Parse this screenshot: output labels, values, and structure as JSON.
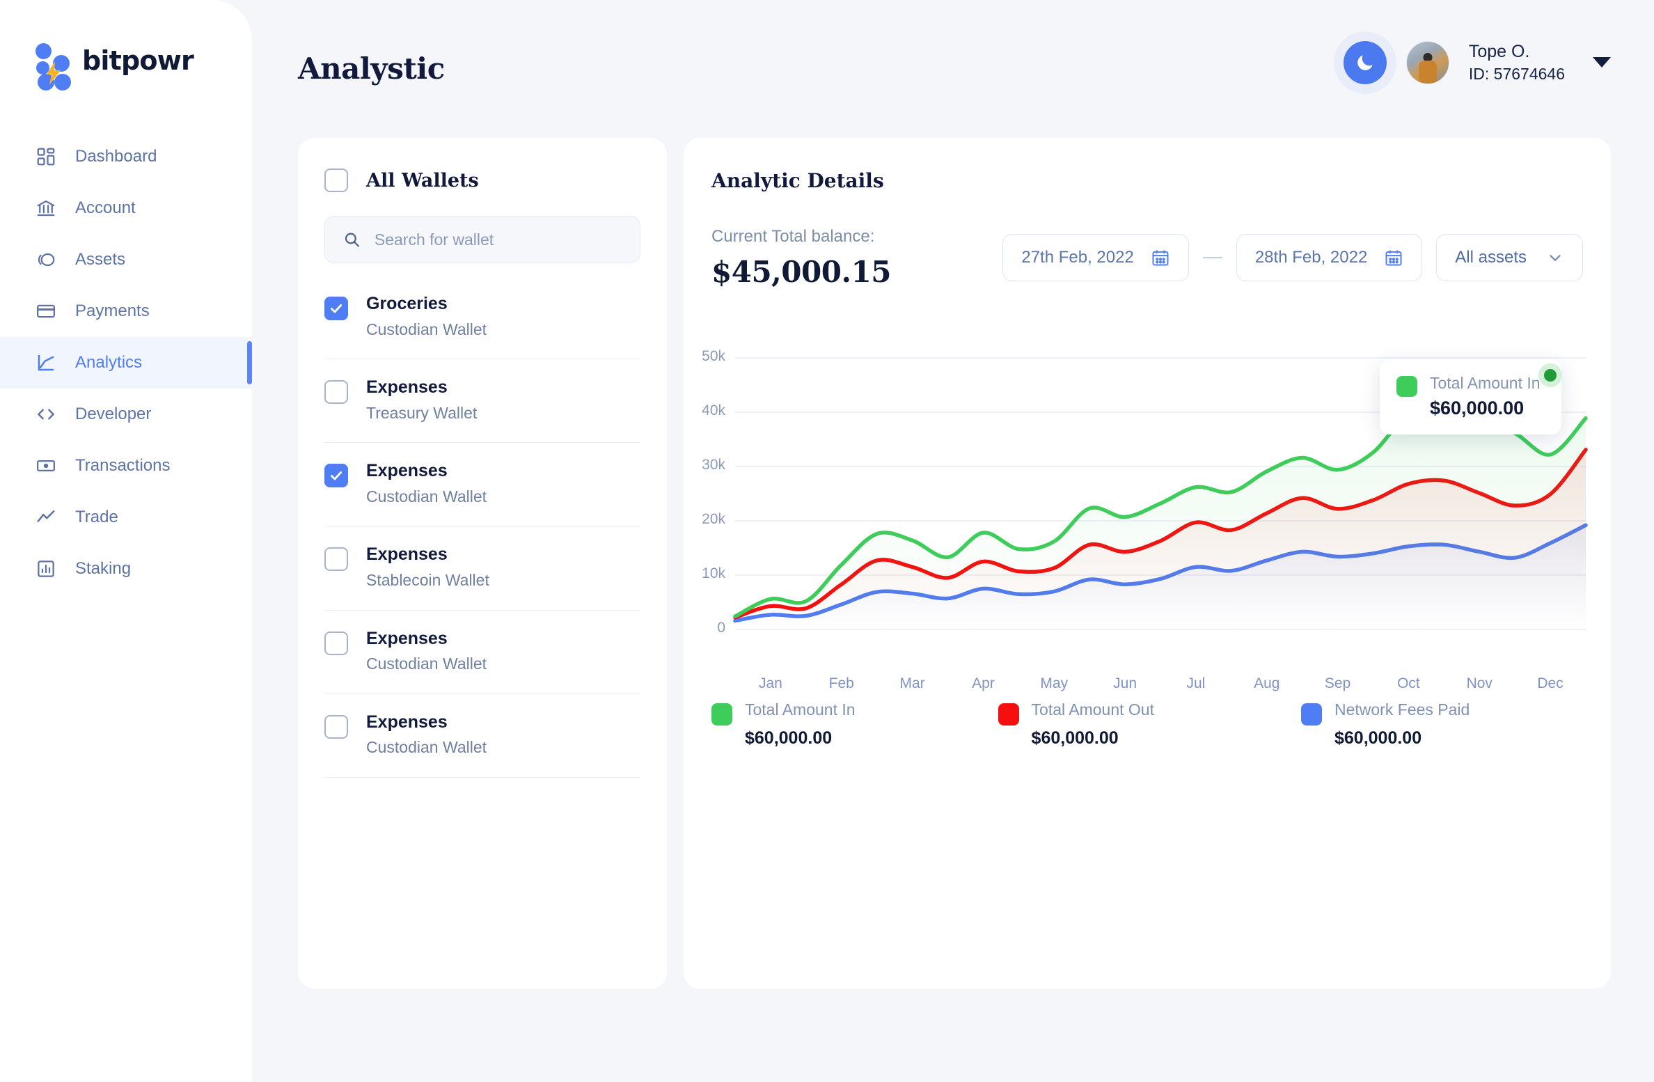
{
  "brand": {
    "name": "bitpowr"
  },
  "header": {
    "page_title": "Analystic",
    "theme_toggle_icon": "moon-icon",
    "user": {
      "name": "Tope O.",
      "id_label": "ID: 57674646"
    }
  },
  "sidebar": {
    "items": [
      {
        "label": "Dashboard",
        "icon": "dashboard-icon",
        "active": false
      },
      {
        "label": "Account",
        "icon": "bank-icon",
        "active": false
      },
      {
        "label": "Assets",
        "icon": "assets-icon",
        "active": false
      },
      {
        "label": "Payments",
        "icon": "card-icon",
        "active": false
      },
      {
        "label": "Analytics",
        "icon": "analytics-icon",
        "active": true
      },
      {
        "label": "Developer",
        "icon": "code-icon",
        "active": false
      },
      {
        "label": "Transactions",
        "icon": "banknote-icon",
        "active": false
      },
      {
        "label": "Trade",
        "icon": "trend-icon",
        "active": false
      },
      {
        "label": "Staking",
        "icon": "bar-chart-icon",
        "active": false
      }
    ]
  },
  "wallets_panel": {
    "all_wallets_label": "All Wallets",
    "all_wallets_checked": false,
    "search": {
      "placeholder": "Search for wallet",
      "value": "",
      "icon": "search-icon"
    },
    "items": [
      {
        "name": "Groceries",
        "type": "Custodian Wallet",
        "checked": true
      },
      {
        "name": "Expenses",
        "type": "Treasury Wallet",
        "checked": false
      },
      {
        "name": "Expenses",
        "type": "Custodian Wallet",
        "checked": true
      },
      {
        "name": "Expenses",
        "type": "Stablecoin Wallet",
        "checked": false
      },
      {
        "name": "Expenses",
        "type": "Custodian Wallet",
        "checked": false
      },
      {
        "name": "Expenses",
        "type": "Custodian Wallet",
        "checked": false
      }
    ]
  },
  "analytic": {
    "title": "Analytic Details",
    "balance_label": "Current Total balance:",
    "balance_value": "$45,000.15",
    "date_from": "27th Feb, 2022",
    "date_to": "28th Feb, 2022",
    "date_icon": "calendar-icon",
    "range_separator": "—",
    "asset_filter": "All assets",
    "asset_filter_icon": "chevron-down-icon",
    "tooltip": {
      "series_name": "Total Amount In",
      "value": "$60,000.00",
      "color": "#3ecd5a"
    },
    "legend": [
      {
        "name": "Total Amount In",
        "value": "$60,000.00",
        "color": "#3ecd5a"
      },
      {
        "name": "Total Amount Out",
        "value": "$60,000.00",
        "color": "#f50f0f"
      },
      {
        "name": "Network Fees Paid",
        "value": "$60,000.00",
        "color": "#4f7df3"
      }
    ]
  },
  "colors": {
    "accent": "#4f7df3",
    "page_bg": "#f4f6fa",
    "card_bg": "#ffffff",
    "text_dark": "#101935",
    "text_muted": "#7d8cab",
    "green": "#3ecd5a",
    "red": "#f50f0f",
    "blue": "#4f7df3"
  },
  "chart_data": {
    "type": "line",
    "title": "",
    "xlabel": "",
    "ylabel": "",
    "ylim": [
      0,
      50000
    ],
    "y_ticks": [
      0,
      10000,
      20000,
      30000,
      40000,
      50000
    ],
    "y_tick_labels": [
      "0",
      "10k",
      "20k",
      "30k",
      "40k",
      "50k"
    ],
    "grid": true,
    "legend_position": "bottom",
    "categories": [
      "Jan",
      "Feb",
      "Mar",
      "Apr",
      "May",
      "Jun",
      "Jul",
      "Aug",
      "Sep",
      "Oct",
      "Nov",
      "Dec"
    ],
    "x_tick_labels": [
      "Jan",
      "Feb",
      "Mar",
      "Apr",
      "May",
      "Jun",
      "Jul",
      "Aug",
      "Sep",
      "Oct",
      "Nov",
      "Dec"
    ],
    "series": [
      {
        "name": "Total Amount In",
        "color": "#3ecd5a",
        "values": [
          2400,
          5600,
          5200,
          11900,
          17600,
          16400,
          13300,
          17800,
          14800,
          16200,
          22300,
          20700,
          23200,
          26200,
          25300,
          29100,
          31600,
          29400,
          32600,
          39800,
          41900,
          38200,
          36100,
          32200,
          38900
        ]
      },
      {
        "name": "Total Amount Out",
        "color": "#f50f0f",
        "values": [
          2200,
          4300,
          3900,
          8300,
          12700,
          11500,
          9500,
          12500,
          10700,
          11300,
          15600,
          14300,
          16300,
          19700,
          18300,
          21400,
          24200,
          22200,
          23800,
          26800,
          27400,
          25100,
          22800,
          24900,
          33100
        ]
      },
      {
        "name": "Network Fees Paid",
        "color": "#4f7df3",
        "values": [
          1600,
          2700,
          2500,
          4600,
          6900,
          6600,
          5700,
          7500,
          6500,
          7000,
          9200,
          8300,
          9300,
          11500,
          10800,
          12700,
          14300,
          13400,
          14000,
          15300,
          15600,
          14300,
          13200,
          15900,
          19200
        ]
      }
    ]
  }
}
